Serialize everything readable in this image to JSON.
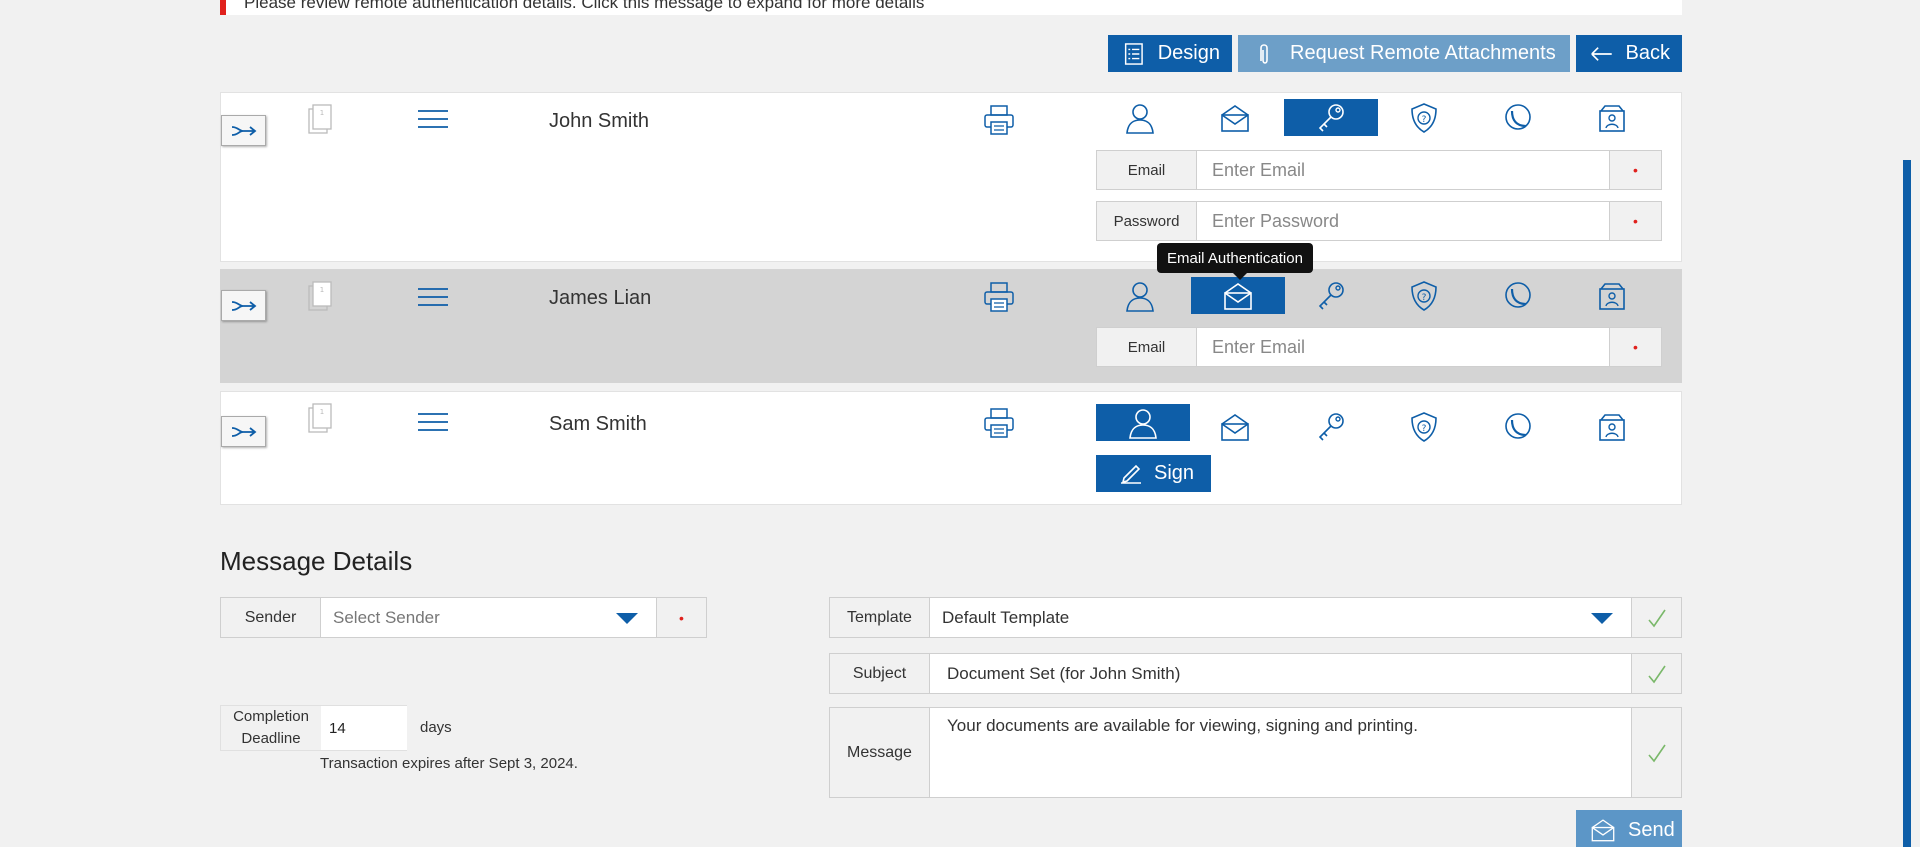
{
  "notice": {
    "text": "Please review remote authentication details. Click this message to expand for more details"
  },
  "toolbar": {
    "design": "Design",
    "request_attachments": "Request Remote Attachments",
    "back": "Back"
  },
  "signers": [
    {
      "name": "John Smith",
      "active_auth": "password-key-icon",
      "fields": [
        {
          "label": "Email",
          "placeholder": "Enter Email"
        },
        {
          "label": "Password",
          "placeholder": "Enter Password"
        }
      ]
    },
    {
      "name": "James Lian",
      "active_auth": "email-envelope-icon",
      "fields": [
        {
          "label": "Email",
          "placeholder": "Enter Email"
        }
      ]
    },
    {
      "name": "Sam Smith",
      "active_auth": "person-icon",
      "sign_label": "Sign"
    }
  ],
  "required_marker": "•",
  "tooltip": "Email Authentication",
  "message_details": {
    "title": "Message Details",
    "sender": {
      "label": "Sender",
      "placeholder": "Select Sender"
    },
    "completion": {
      "label_line1": "Completion",
      "label_line2": "Deadline",
      "value": "14",
      "unit": "days",
      "expires": "Transaction expires after Sept 3, 2024."
    },
    "template": {
      "label": "Template",
      "value": "Default Template"
    },
    "subject": {
      "label": "Subject",
      "value": "Document Set (for John Smith)"
    },
    "message": {
      "label": "Message",
      "value": "Your documents are available for viewing, signing and printing."
    }
  },
  "send_label": "Send",
  "colors": {
    "primary": "#0e5ea8",
    "primary_light": "#6d9fc8",
    "alert": "#e0211d",
    "check": "#7ab86a"
  }
}
